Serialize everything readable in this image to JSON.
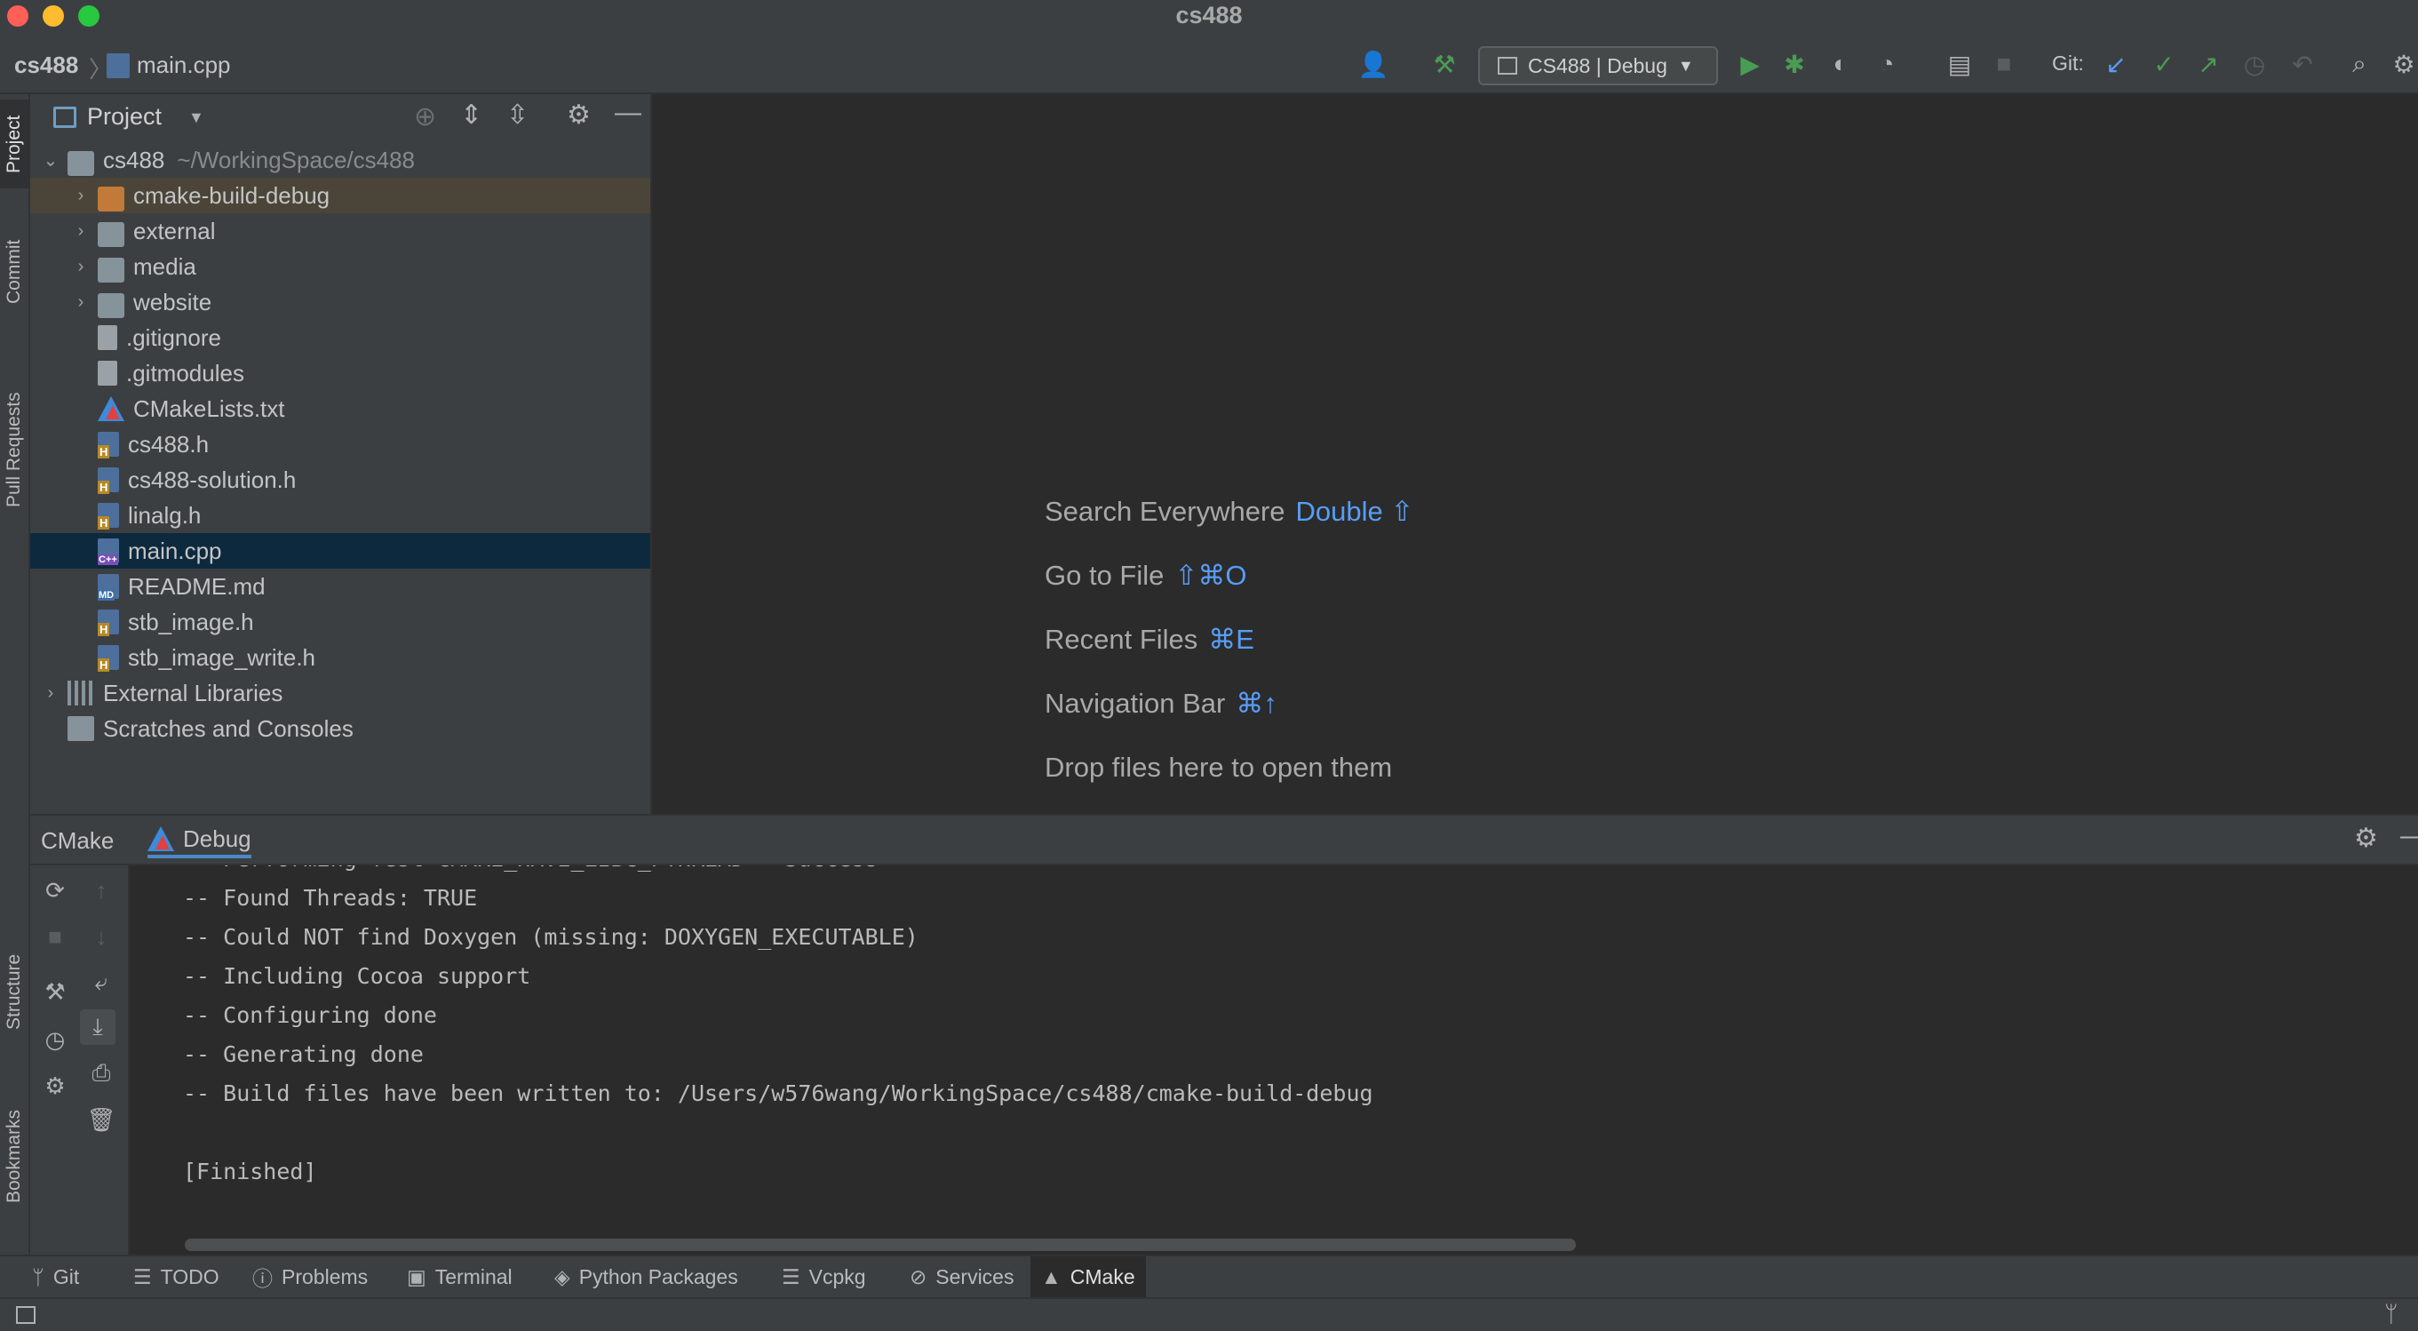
{
  "window": {
    "title": "cs488"
  },
  "navbar": {
    "breadcrumbs": [
      "cs488",
      "main.cpp"
    ],
    "run_config": "CS488 | Debug",
    "git_label": "Git:"
  },
  "left_strip": {
    "tabs": [
      "Project",
      "Commit",
      "Pull Requests",
      "Structure",
      "Bookmarks"
    ]
  },
  "project": {
    "header": "Project",
    "root": {
      "name": "cs488",
      "path": "~/WorkingSpace/cs488"
    },
    "items": [
      {
        "name": "cmake-build-debug",
        "type": "folder-orange"
      },
      {
        "name": "external",
        "type": "folder"
      },
      {
        "name": "media",
        "type": "folder"
      },
      {
        "name": "website",
        "type": "folder"
      },
      {
        "name": ".gitignore",
        "type": "doc"
      },
      {
        "name": ".gitmodules",
        "type": "doc"
      },
      {
        "name": "CMakeLists.txt",
        "type": "cmake"
      },
      {
        "name": "cs488.h",
        "type": "h"
      },
      {
        "name": "cs488-solution.h",
        "type": "h"
      },
      {
        "name": "linalg.h",
        "type": "h"
      },
      {
        "name": "main.cpp",
        "type": "cpp"
      },
      {
        "name": "README.md",
        "type": "md"
      },
      {
        "name": "stb_image.h",
        "type": "h"
      },
      {
        "name": "stb_image_write.h",
        "type": "h"
      }
    ],
    "external_libraries": "External Libraries",
    "scratches": "Scratches and Consoles"
  },
  "editor": {
    "hints": [
      {
        "label": "Search Everywhere",
        "key": "Double ⇧"
      },
      {
        "label": "Go to File",
        "key": "⇧⌘O"
      },
      {
        "label": "Recent Files",
        "key": "⌘E"
      },
      {
        "label": "Navigation Bar",
        "key": "⌘↑"
      },
      {
        "label": "Drop files here to open them",
        "key": ""
      }
    ]
  },
  "bottom_panel": {
    "tabs": [
      "CMake",
      "Debug"
    ],
    "console_lines": [
      "-- Performing Test CMAKE_HAVE_LIBC_PTHREAD - Success",
      "-- Found Threads: TRUE",
      "-- Could NOT find Doxygen (missing: DOXYGEN_EXECUTABLE)",
      "-- Including Cocoa support",
      "-- Configuring done",
      "-- Generating done",
      "-- Build files have been written to: /Users/w576wang/WorkingSpace/cs488/cmake-build-debug",
      "",
      "[Finished]"
    ]
  },
  "bottom_tabs": [
    "Git",
    "TODO",
    "Problems",
    "Terminal",
    "Python Packages",
    "Vcpkg",
    "Services",
    "CMake"
  ],
  "colors": {
    "accent_blue": "#589df6",
    "selection": "#0d293e",
    "run_green": "#499c54",
    "folder_orange": "#c27a3a"
  }
}
